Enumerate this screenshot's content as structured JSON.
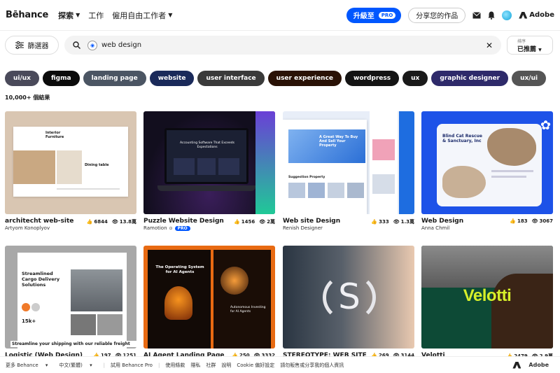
{
  "nav": {
    "logo": "Bēhance",
    "links": [
      "探索",
      "工作",
      "僱用自由工作者"
    ],
    "upgrade_label": "升級至",
    "upgrade_pro": "PRO",
    "share_label": "分享您的作品",
    "adobe_label": "Adobe"
  },
  "search": {
    "filter_label": "篩選器",
    "query": "web design",
    "sort_label": "排序",
    "sort_value": "已推薦"
  },
  "tags": [
    {
      "label": "ui/ux",
      "color": "#4a4a5a"
    },
    {
      "label": "figma",
      "color": "#0b0b0b"
    },
    {
      "label": "landing page",
      "color": "#4b5563"
    },
    {
      "label": "website",
      "color": "#1a2a5a"
    },
    {
      "label": "user interface",
      "color": "#3a3a3a"
    },
    {
      "label": "user experience",
      "color": "#2a1206"
    },
    {
      "label": "wordpress",
      "color": "#141414"
    },
    {
      "label": "ux",
      "color": "#1a1a1a"
    },
    {
      "label": "graphic designer",
      "color": "#2e2a6a"
    },
    {
      "label": "ux/ui",
      "color": "#555555"
    }
  ],
  "result_count": "10,000+ 個結果",
  "cards": [
    {
      "title": "architecht web-site",
      "author": "Artyom Konoplyov",
      "likes": "6844",
      "views": "13.8萬",
      "pro": ""
    },
    {
      "title": "Puzzle Website Design",
      "author": "Ramotion",
      "likes": "1456",
      "views": "2萬",
      "pro": "PRO"
    },
    {
      "title": "Web site Design",
      "author": "Renish Designer",
      "likes": "333",
      "views": "1.3萬",
      "pro": ""
    },
    {
      "title": "Web Design",
      "author": "Anna Chmil",
      "likes": "183",
      "views": "3067",
      "pro": ""
    },
    {
      "title": "Logistic (Web Design)",
      "author": "",
      "likes": "197",
      "views": "1251",
      "pro": ""
    },
    {
      "title": "AI Agent Landing Page",
      "author": "",
      "likes": "250",
      "views": "3332",
      "pro": ""
    },
    {
      "title": "STEREOTYPE: WEB SITE",
      "author": "",
      "likes": "269",
      "views": "3144",
      "pro": ""
    },
    {
      "title": "Velotti",
      "author": "",
      "likes": "2479",
      "views": "2.9萬",
      "pro": ""
    }
  ],
  "thumbs": {
    "c1_heading": "Interior Furniture",
    "c1_sub": "Dining table",
    "c2_heading": "Accounting Software That Exceeds Expectations",
    "c3_heading": "A Great Way To Buy And Sell Your Property",
    "c3_sub": "Suggestion Property",
    "c4_heading": "Blind Cat Rescue & Sanctuary, Inc",
    "c5_heading": "Streamlined Cargo Delivery Solutions",
    "c5_stat": "15k+",
    "c5_sub": "Streamline your shipping with our reliable freight",
    "c6_heading": "The Operating System for AI Agents",
    "c6_sub": "Autonomous Investing for AI Agents",
    "c7_glyph": "S",
    "c8_word": "Velotti"
  },
  "footer": {
    "items": [
      "更多 Behance",
      "中文(繁體)",
      "試用 Behance Pro",
      "使用條款",
      "隱私",
      "社群",
      "說明",
      "Cookie 偏好設定",
      "請勿販售或分享我的個人資訊"
    ],
    "adobe": "Adobe"
  }
}
